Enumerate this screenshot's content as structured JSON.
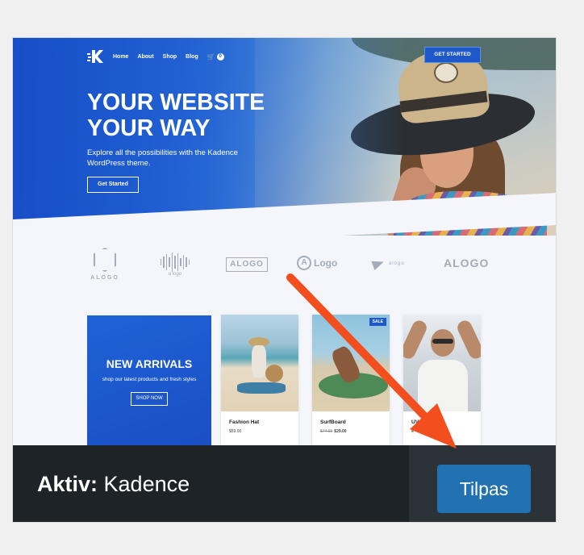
{
  "nav": {
    "links": [
      "Home",
      "About",
      "Shop",
      "Blog"
    ],
    "cart_count": "0",
    "cta_label": "GET STARTED"
  },
  "hero": {
    "title_line1": "YOUR WEBSITE",
    "title_line2": "YOUR WAY",
    "subtitle": "Explore all the possibilities with the Kadence WordPress theme.",
    "button_label": "Get Started"
  },
  "logos": {
    "logo1": "ALOGO",
    "logo2": "a logo",
    "logo3": "ALOGO",
    "logo4_letter": "A",
    "logo4": "Logo",
    "logo5": "alogo",
    "logo6": "ALOGO"
  },
  "promo": {
    "title": "NEW ARRIVALS",
    "subtitle": "shop our latest products and fresh styles",
    "button_label": "SHOP NOW"
  },
  "products": [
    {
      "name": "Fashion Hat",
      "old_price": "",
      "price": "$59.00",
      "badge": ""
    },
    {
      "name": "SurfBoard",
      "old_price": "$74.00",
      "price": "$29.00",
      "badge": "SALE"
    },
    {
      "name": "UV S",
      "old_price": "$",
      "price": "",
      "badge": ""
    }
  ],
  "theme_bar": {
    "active_prefix": "Aktiv:",
    "theme_name": "Kadence",
    "customize_label": "Tilpas"
  },
  "colors": {
    "accent": "#2271b1",
    "footer_bg": "#1d2327",
    "hero_blue": "#1e58c9",
    "arrow": "#f24e1e"
  }
}
